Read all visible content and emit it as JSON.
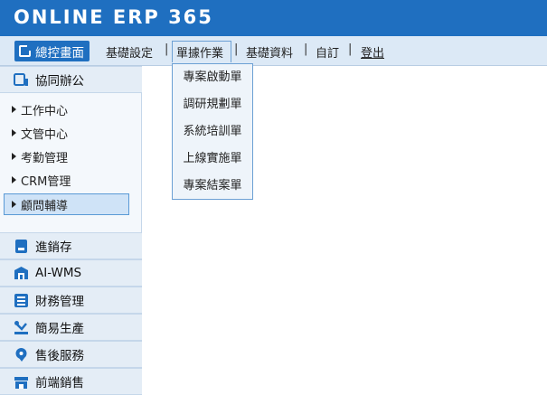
{
  "app": {
    "logo_text": "ONLINE ERP 365"
  },
  "menubar": {
    "home_label": "總控畫面",
    "items": [
      {
        "label": "基礎設定"
      },
      {
        "label": "單據作業"
      },
      {
        "label": "基礎資料"
      },
      {
        "label": "自訂"
      },
      {
        "label": "登出"
      }
    ],
    "separator": "|"
  },
  "dropdown": {
    "items": [
      "專案啟動單",
      "調研規劃單",
      "系統培訓單",
      "上線實施單",
      "專案結案單"
    ]
  },
  "sidebar": {
    "groups": [
      {
        "label": "協同辦公",
        "icon": "collab-icon"
      },
      {
        "label": "進銷存",
        "icon": "inventory-icon"
      },
      {
        "label": "AI-WMS",
        "icon": "wms-icon"
      },
      {
        "label": "財務管理",
        "icon": "finance-icon"
      },
      {
        "label": "簡易生產",
        "icon": "production-icon"
      },
      {
        "label": "售後服務",
        "icon": "service-icon"
      },
      {
        "label": "前端銷售",
        "icon": "store-icon"
      }
    ],
    "sub_items": [
      {
        "label": "工作中心"
      },
      {
        "label": "文管中心"
      },
      {
        "label": "考勤管理"
      },
      {
        "label": "CRM管理"
      },
      {
        "label": "顧問輔導",
        "selected": true
      }
    ]
  },
  "colors": {
    "header_bg": "#1f6fc0",
    "menubar_bg": "#dce9f6",
    "sidebar_bg": "#f4f8fc",
    "selected_bg": "#cfe3f7"
  }
}
